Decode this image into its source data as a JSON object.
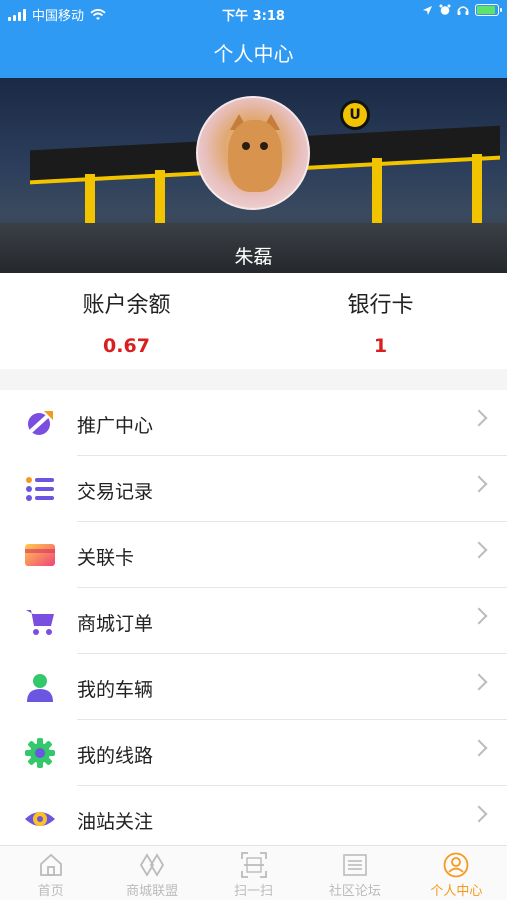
{
  "status_bar": {
    "carrier": "中国移动",
    "time": "下午 3:18"
  },
  "header": {
    "title": "个人中心"
  },
  "profile": {
    "username": "朱磊"
  },
  "stats": [
    {
      "label": "账户余额",
      "value": "0.67"
    },
    {
      "label": "银行卡",
      "value": "1"
    }
  ],
  "menu": [
    {
      "label": "推广中心",
      "icon": "rocket-icon"
    },
    {
      "label": "交易记录",
      "icon": "list-icon"
    },
    {
      "label": "关联卡",
      "icon": "card-icon"
    },
    {
      "label": "商城订单",
      "icon": "cart-icon"
    },
    {
      "label": "我的车辆",
      "icon": "person-icon"
    },
    {
      "label": "我的线路",
      "icon": "gear-icon"
    },
    {
      "label": "油站关注",
      "icon": "eye-icon"
    }
  ],
  "tabbar": [
    {
      "label": "首页",
      "icon": "home-icon"
    },
    {
      "label": "商城联盟",
      "icon": "diamond-icon"
    },
    {
      "label": "扫一扫",
      "icon": "scan-icon"
    },
    {
      "label": "社区论坛",
      "icon": "forum-icon"
    },
    {
      "label": "个人中心",
      "icon": "profile-icon",
      "active": true
    }
  ],
  "colors": {
    "header_bg": "#2f9af3",
    "value_red": "#d81e1e",
    "tab_active": "#f59a1b"
  }
}
